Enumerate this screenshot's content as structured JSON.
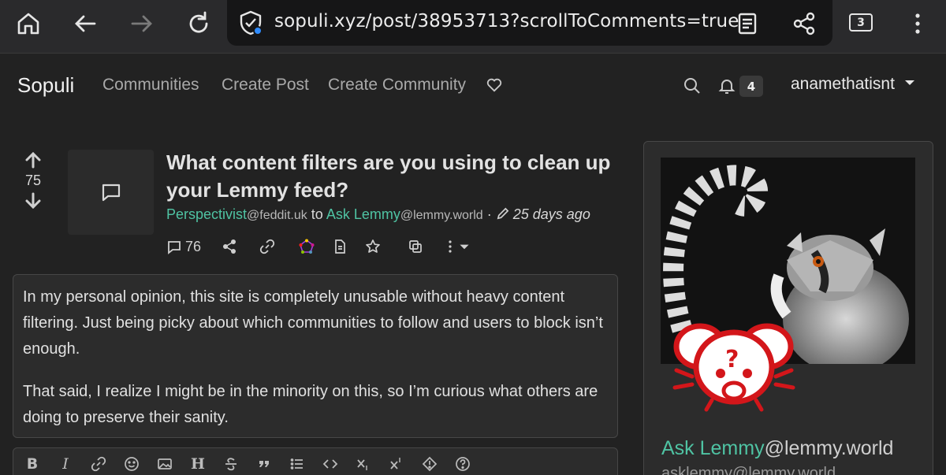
{
  "browser": {
    "url": "sopuli.xyz/post/38953713?scrollToComments=true",
    "tab_count": "3",
    "icons": [
      "home-icon",
      "back-icon",
      "forward-icon",
      "reload-icon",
      "shield-icon",
      "reader-icon",
      "share-icon",
      "tabs-icon",
      "menu-icon"
    ]
  },
  "nav": {
    "brand": "Sopuli",
    "links": [
      "Communities",
      "Create Post",
      "Create Community"
    ],
    "notification_count": "4",
    "username": "anamethatisnt"
  },
  "post": {
    "score": "75",
    "title": "What content filters are you using to clean up your Lemmy feed?",
    "author": "Perspectivist",
    "author_instance": "@feddit.uk",
    "to": "to",
    "community": "Ask Lemmy",
    "community_instance": "@lemmy.world",
    "time": "25 days ago",
    "comment_count": "76",
    "body": [
      "In my personal opinion, this site is completely unusable without heavy content filtering. Just being picky about which communities to follow and users to block isn’t enough.",
      "That said, I realize I might be in the minority on this, so I’m curious what others are doing to preserve their sanity."
    ]
  },
  "editor_toolbar": {
    "buttons": [
      "B",
      "I",
      "H"
    ]
  },
  "sidebar": {
    "community_name": "Ask Lemmy",
    "community_instance": "@lemmy.world",
    "community_handle": "asklemmy@lemmy.world"
  },
  "colors": {
    "accent_green": "#4fc3a3",
    "background": "#222222"
  }
}
